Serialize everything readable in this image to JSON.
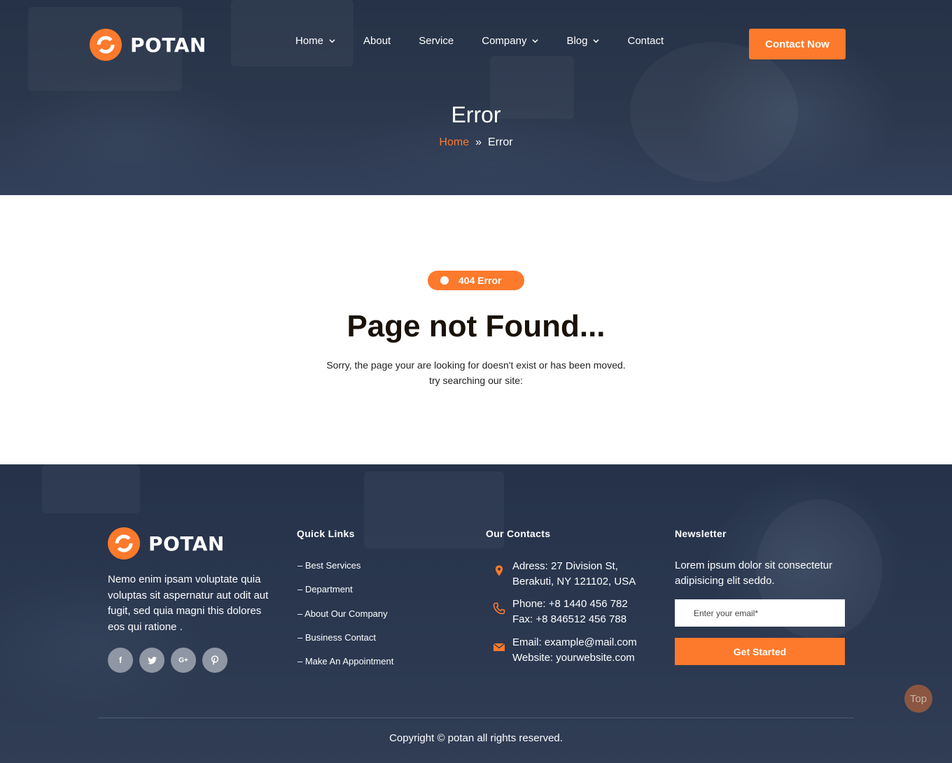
{
  "brand": {
    "name": "POTAN",
    "accent": "#fd7a2c",
    "dark": "#263247"
  },
  "header": {
    "nav": [
      {
        "label": "Home",
        "dropdown": true
      },
      {
        "label": "About",
        "dropdown": false
      },
      {
        "label": "Service",
        "dropdown": false
      },
      {
        "label": "Company",
        "dropdown": true
      },
      {
        "label": "Blog",
        "dropdown": true
      },
      {
        "label": "Contact",
        "dropdown": false
      }
    ],
    "cta_label": "Contact Now"
  },
  "hero": {
    "title": "Error",
    "breadcrumb": {
      "home": "Home",
      "separator": "»",
      "current": "Error"
    }
  },
  "main": {
    "badge": "404 Error",
    "title": "Page not Found...",
    "line1": "Sorry, the page your are looking for doesn't exist or has been moved.",
    "line2": "try searching our site:"
  },
  "footer": {
    "about": {
      "text": "Nemo enim ipsam voluptate quia voluptas sit aspernatur aut odit aut fugit, sed quia magni this dolores eos qui ratione .",
      "socials": [
        {
          "icon": "facebook-icon",
          "glyph": "f"
        },
        {
          "icon": "twitter-icon",
          "glyph": "t"
        },
        {
          "icon": "google-plus-icon",
          "glyph": "G+"
        },
        {
          "icon": "pinterest-icon",
          "glyph": "p"
        }
      ]
    },
    "quick_links": {
      "title": "Quick Links",
      "items": [
        "– Best Services",
        "– Department",
        "– About Our Company",
        "– Business Contact",
        "– Make An Appointment"
      ]
    },
    "contacts": {
      "title": "Our Contacts",
      "address": [
        "Adress: 27 Division St,",
        "Berakuti, NY 121102, USA"
      ],
      "phone": [
        "Phone: +8 1440 456 782",
        "Fax: +8 846512 456 788"
      ],
      "email": [
        "Email: example@mail.com",
        "Website: yourwebsite.com"
      ]
    },
    "newsletter": {
      "title": "Newsletter",
      "text": "Lorem ipsum dolor sit consectetur adipisicing elit seddo.",
      "placeholder": "Enter your email*",
      "button": "Get Started"
    },
    "top_label": "Top",
    "copyright": "Copyright © potan all rights reserved."
  }
}
